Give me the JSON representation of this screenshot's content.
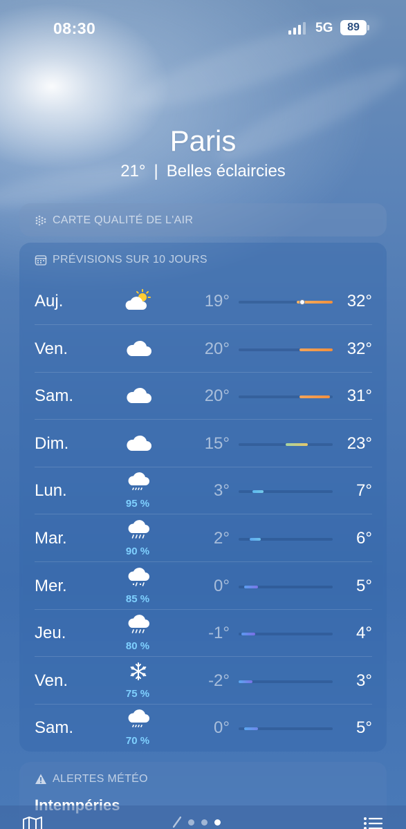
{
  "status_bar": {
    "time": "08:30",
    "network": "5G",
    "battery": "89",
    "signal_icon": "cellular-signal-icon"
  },
  "header": {
    "city": "Paris",
    "temperature": "21°",
    "separator": "|",
    "condition": "Belles éclaircies"
  },
  "air_quality": {
    "title": "CARTE QUALITÉ DE L'AIR",
    "icon": "air-quality-icon"
  },
  "forecast": {
    "title": "PRÉVISIONS SUR 10 JOURS",
    "icon": "calendar-icon",
    "scale_min": -2,
    "scale_max": 32,
    "days": [
      {
        "day": "Auj.",
        "icon": "sun-behind-cloud-icon",
        "precip": "",
        "low": "19°",
        "high": "32°",
        "low_val": 19,
        "high_val": 32,
        "current": 21,
        "colors": [
          "#f4b366",
          "#f28f3b"
        ]
      },
      {
        "day": "Ven.",
        "icon": "cloud-icon",
        "precip": "",
        "low": "20°",
        "high": "32°",
        "low_val": 20,
        "high_val": 32,
        "colors": [
          "#f2a45a",
          "#f28f3b"
        ]
      },
      {
        "day": "Sam.",
        "icon": "cloud-icon",
        "precip": "",
        "low": "20°",
        "high": "31°",
        "low_val": 20,
        "high_val": 31,
        "colors": [
          "#f2a45a",
          "#f29040"
        ]
      },
      {
        "day": "Dim.",
        "icon": "cloud-icon",
        "precip": "",
        "low": "15°",
        "high": "23°",
        "low_val": 15,
        "high_val": 23,
        "colors": [
          "#a6d3a1",
          "#e5c66a"
        ]
      },
      {
        "day": "Lun.",
        "icon": "cloud-drizzle-icon",
        "precip": "95 %",
        "low": "3°",
        "high": "7°",
        "low_val": 3,
        "high_val": 7,
        "colors": [
          "#5cb8f0",
          "#74c9e8"
        ]
      },
      {
        "day": "Mar.",
        "icon": "cloud-rain-icon",
        "precip": "90 %",
        "low": "2°",
        "high": "6°",
        "low_val": 2,
        "high_val": 6,
        "colors": [
          "#5ca8f0",
          "#6cc0ea"
        ]
      },
      {
        "day": "Mer.",
        "icon": "cloud-sleet-icon",
        "precip": "85 %",
        "low": "0°",
        "high": "5°",
        "low_val": 0,
        "high_val": 5,
        "colors": [
          "#5aa0f0",
          "#7b74e6"
        ]
      },
      {
        "day": "Jeu.",
        "icon": "cloud-rain-icon",
        "precip": "80 %",
        "low": "-1°",
        "high": "4°",
        "low_val": -1,
        "high_val": 4,
        "colors": [
          "#5a9af0",
          "#7a6ee6"
        ]
      },
      {
        "day": "Ven.",
        "icon": "snowflake-icon",
        "precip": "75 %",
        "low": "-2°",
        "high": "3°",
        "low_val": -2,
        "high_val": 3,
        "colors": [
          "#5aa8f0",
          "#7a72e6"
        ]
      },
      {
        "day": "Sam.",
        "icon": "cloud-drizzle-icon",
        "precip": "70 %",
        "low": "0°",
        "high": "5°",
        "low_val": 0,
        "high_val": 5,
        "colors": [
          "#5aa8f0",
          "#6e86ea"
        ]
      }
    ]
  },
  "alerts": {
    "title": "ALERTES MÉTÉO",
    "icon": "warning-icon",
    "text": "Intempéries"
  },
  "bottom_bar": {
    "map_icon": "map-icon",
    "location_icon": "location-arrow-icon",
    "list_icon": "list-icon"
  }
}
